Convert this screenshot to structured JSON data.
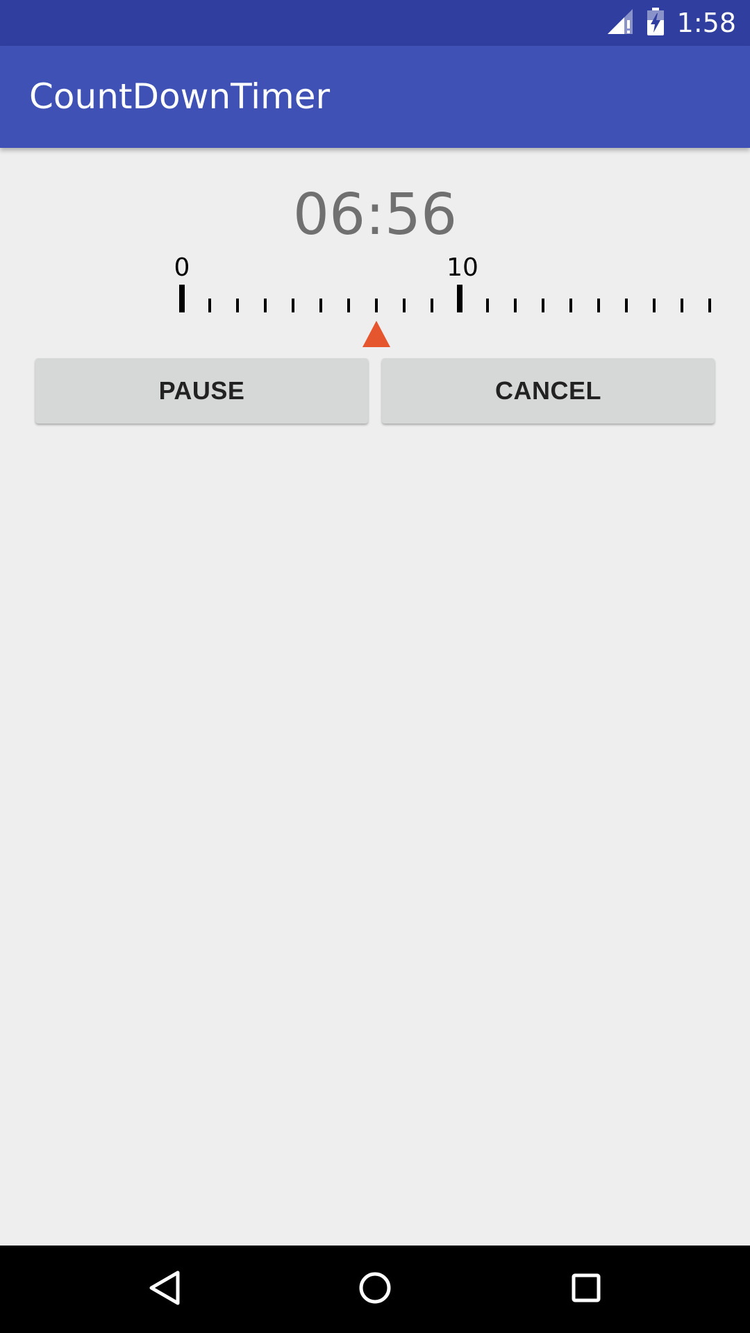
{
  "status_bar": {
    "time": "1:58",
    "icons": [
      "signal-icon",
      "battery-charging-icon"
    ]
  },
  "app_bar": {
    "title": "CountDownTimer"
  },
  "timer": {
    "display": "06:56",
    "ruler": {
      "labels": [
        "0",
        "10"
      ],
      "min": 0,
      "max": 19,
      "pointer_value": 7,
      "pointer_color": "#e5552e"
    }
  },
  "buttons": {
    "pause_label": "PAUSE",
    "cancel_label": "CANCEL"
  },
  "nav_bar": {
    "icons": [
      "back-icon",
      "home-icon",
      "recents-icon"
    ]
  },
  "colors": {
    "primary_dark": "#303f9f",
    "primary": "#3f51b5",
    "background": "#eeeeee",
    "timer_text": "#707070",
    "accent": "#e5552e"
  }
}
